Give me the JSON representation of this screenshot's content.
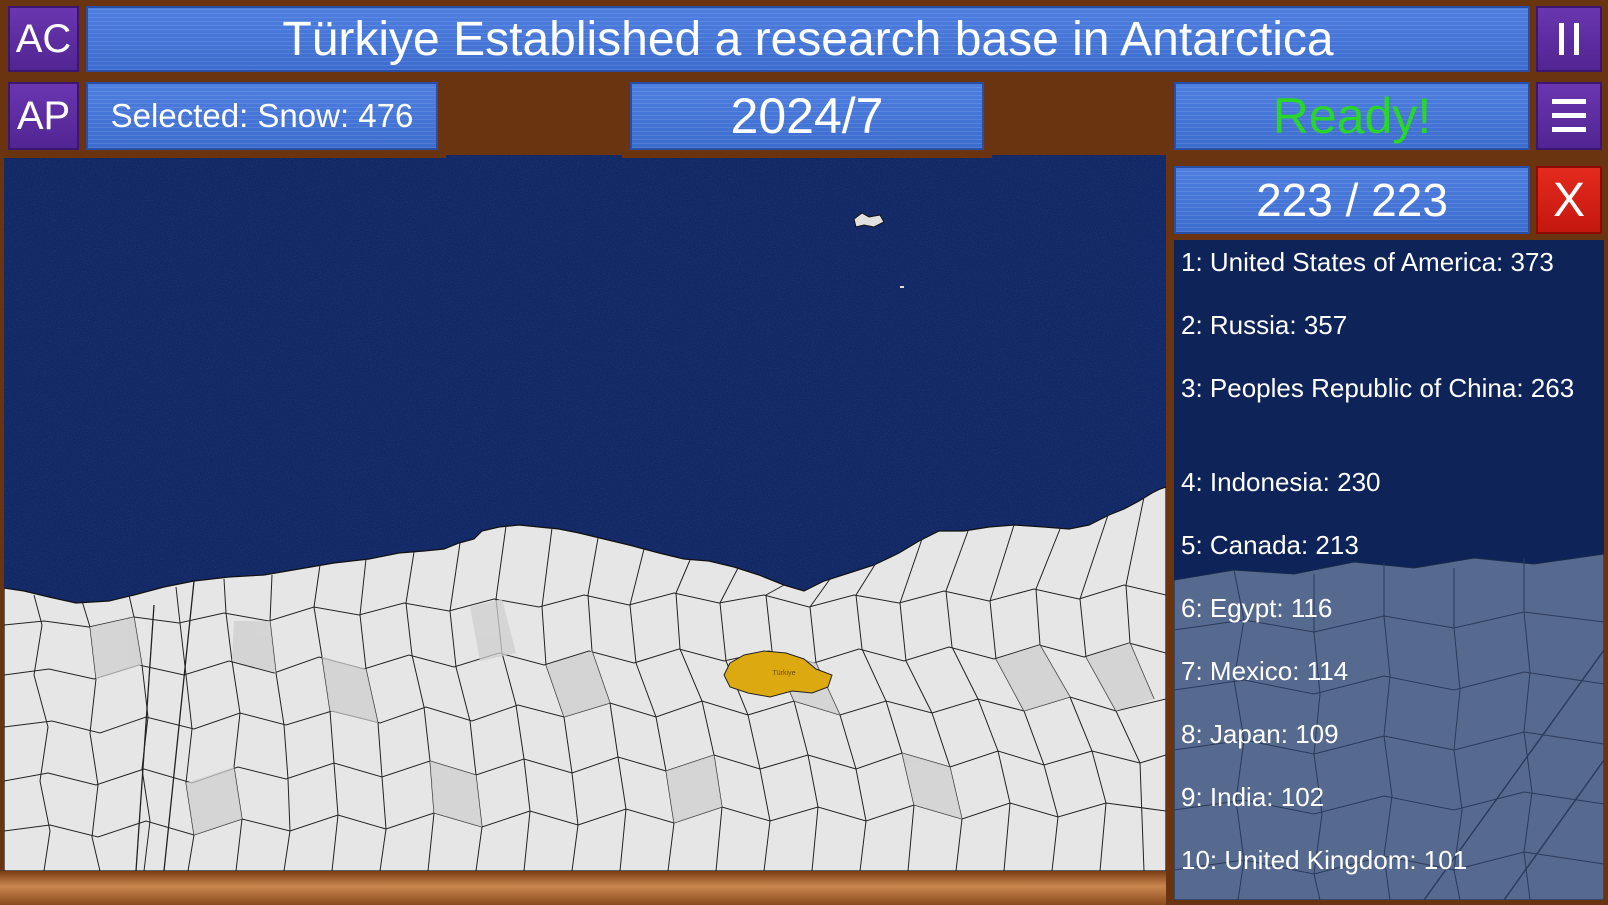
{
  "header": {
    "ac_button": "AC",
    "ap_button": "AP",
    "headline": "Türkiye Established a research base in Antarctica",
    "pause_icon": "pause-icon",
    "menu_icon": "hamburger-menu-icon"
  },
  "status": {
    "selected": "Selected: Snow: 476",
    "date": "2024/7",
    "ready": "Ready!",
    "ready_color": "#29d629"
  },
  "ranking": {
    "counter": "223 / 223",
    "close_label": "X",
    "items": [
      "1: United States of America: 373",
      "2: Russia: 357",
      "3: Peoples Republic of China: 263",
      "4: Indonesia: 230",
      "5: Canada: 213",
      "6: Egypt: 116",
      "7: Mexico: 114",
      "8: Japan: 109",
      "9: India: 102",
      "10: United Kingdom: 101"
    ]
  },
  "map": {
    "highlighted_region": "Türkiye",
    "highlight_color": "#dcaa10",
    "ocean_color": "#0b1f5c",
    "ice_color": "#e6e6e6"
  },
  "colors": {
    "panel_blue": "#4575d9",
    "button_purple": "#5c2ca0",
    "close_red": "#d81f16",
    "frame_brown": "#6a3410"
  }
}
